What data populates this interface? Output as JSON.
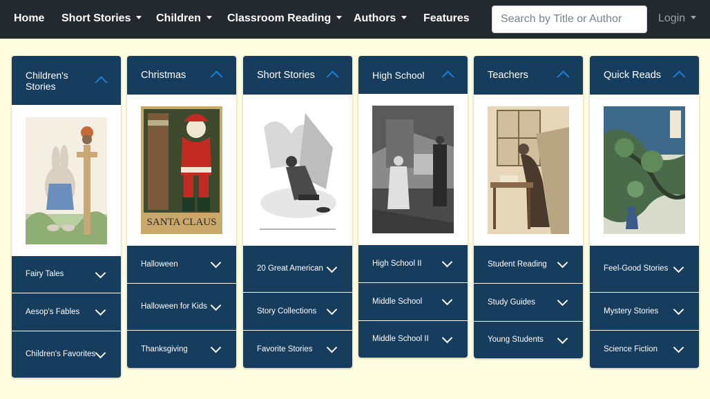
{
  "nav": {
    "home": "Home",
    "short_stories": "Short Stories",
    "children": "Children",
    "classroom_reading": "Classroom Reading",
    "authors": "Authors",
    "features": "Features",
    "search_placeholder": "Search by Title or Author",
    "login": "Login"
  },
  "columns": [
    {
      "title": "Children's Stories",
      "items": [
        "Fairy Tales",
        "Aesop's Fables",
        "Children's Favorites"
      ]
    },
    {
      "title": "Christmas",
      "image_caption": "SANTA CLAUS",
      "items": [
        "Halloween",
        "Halloween for Kids",
        "Thanksgiving"
      ]
    },
    {
      "title": "Short Stories",
      "items": [
        "20 Great American",
        "Story Collections",
        "Favorite Stories"
      ]
    },
    {
      "title": "High School",
      "items": [
        "High School II",
        "Middle School",
        "Middle School II"
      ]
    },
    {
      "title": "Teachers",
      "items": [
        "Student Reading",
        "Study Guides",
        "Young Students"
      ]
    },
    {
      "title": "Quick Reads",
      "items": [
        "Feel-Good Stories",
        "Mystery Stories",
        "Science Fiction"
      ]
    }
  ],
  "colors": {
    "navbar": "#222a30",
    "panel": "#163c5e",
    "page_background": "#fffde0",
    "chevron_accent": "#1a7fd6"
  },
  "icons": [
    "chevron-up-icon",
    "chevron-down-icon",
    "caret-down-icon"
  ]
}
